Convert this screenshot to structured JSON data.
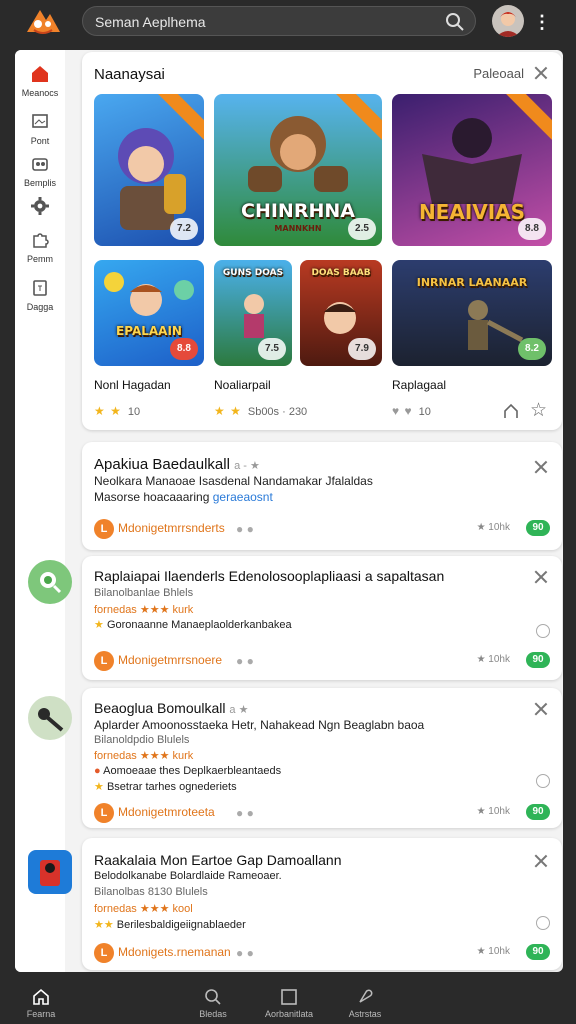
{
  "search": {
    "query": "Seman Aeplhema"
  },
  "rail": [
    {
      "label": "Meanocs",
      "icon": "home-icon",
      "color": "#e0341d"
    },
    {
      "label": "Pont",
      "icon": "image-icon"
    },
    {
      "label": "Bemplis",
      "icon": "people-icon"
    },
    {
      "label": "",
      "icon": "gear-icon"
    },
    {
      "label": "Pemm",
      "icon": "puzzle-icon"
    },
    {
      "label": "Dagga",
      "icon": "tag-icon"
    }
  ],
  "featured": {
    "title": "Naanaysai",
    "link": "Paleoaal",
    "tiles": [
      {
        "title": "",
        "badge": "7.2"
      },
      {
        "title": "CHINRHNA",
        "subtitle": "MANNKHN",
        "badge": "2.5"
      },
      {
        "title": "NEAIVIAS",
        "badge": "8.8"
      },
      {
        "title": "EPALAAIN",
        "badge": "8.8"
      },
      {
        "title": "GUNS DOAS",
        "badge": "7.5"
      },
      {
        "title": "DOAS BAAB",
        "badge": "7.9"
      },
      {
        "title": "INRNAR LAANAAR",
        "badge": "8.2"
      }
    ],
    "labels": [
      "Nonl Hagadan",
      "Noaliarpail",
      "Raplagaal"
    ],
    "ratings": [
      {
        "stars": "★ ★",
        "count": "10"
      },
      {
        "stars": "★ ★",
        "count": "Sb00s · 230"
      },
      {
        "stars": "",
        "count": "10"
      }
    ]
  },
  "cards": [
    {
      "title": "Apakiua Baedaulkall",
      "title_tail": "a - ★",
      "lines": [
        "Neolkara Manaoae Isasdenal Nandamakar Jfalaldas"
      ],
      "line2_a": "Masorse hoacaaaring",
      "line2_b": "geraeaosnt",
      "footer": "Mdonigetmrrsnderts",
      "rating": "★ 10hk",
      "pill": "90"
    },
    {
      "title": "Raplaiapai Ilaenderls Edenolosooplapliaasi a sapaltasan",
      "sub": "Bilanolbanlae Bhlels",
      "tag": "fornedas ★★★ kurk",
      "detail": "Goronaanne Manaeplaolderkanbakea",
      "footer": "Mdonigetmrrsnoere",
      "rating": "★ 10hk",
      "pill": "90"
    },
    {
      "title": "Beaoglua Bomoulkall",
      "title_tail": "a ★",
      "lines": [
        "Aplarder Amoonosstaeka Hetr, Nahakead Ngn Beaglabn baoa"
      ],
      "sub": "Bilanoldpdio Blulels",
      "tag": "fornedas ★★★ kurk",
      "detail": "Aomoeaae thes Deplkaerbleantaeds",
      "detail2": "Bsetrar tarhes ognederiets",
      "footer": "Mdonigetmroteeta",
      "rating": "★ 10hk",
      "pill": "90"
    },
    {
      "title": "Raakalaia Mon Eartoe Gap Damoallann",
      "lines": [
        "Belodolkanabe Bolardlaide Rameoaer."
      ],
      "sub": "Bilanolbas 8130 Blulels",
      "tag": "fornedas ★★★ kool",
      "detail": "Berilesbaldigeiignablaeder",
      "footer": "Mdonigets.rnemanan",
      "rating": "★ 10hk",
      "pill": "90"
    }
  ],
  "bottomnav": [
    {
      "label": "Fearna",
      "icon": "home-icon"
    },
    {
      "label": "Bledas",
      "icon": "search-icon"
    },
    {
      "label": "Aorbanitlata",
      "icon": "square-icon"
    },
    {
      "label": "Astrstas",
      "icon": "pin-icon"
    }
  ],
  "colors": {
    "accent": "#e0341d",
    "orange": "#f0822a",
    "green": "#2fb457",
    "star": "#f2b51c"
  }
}
